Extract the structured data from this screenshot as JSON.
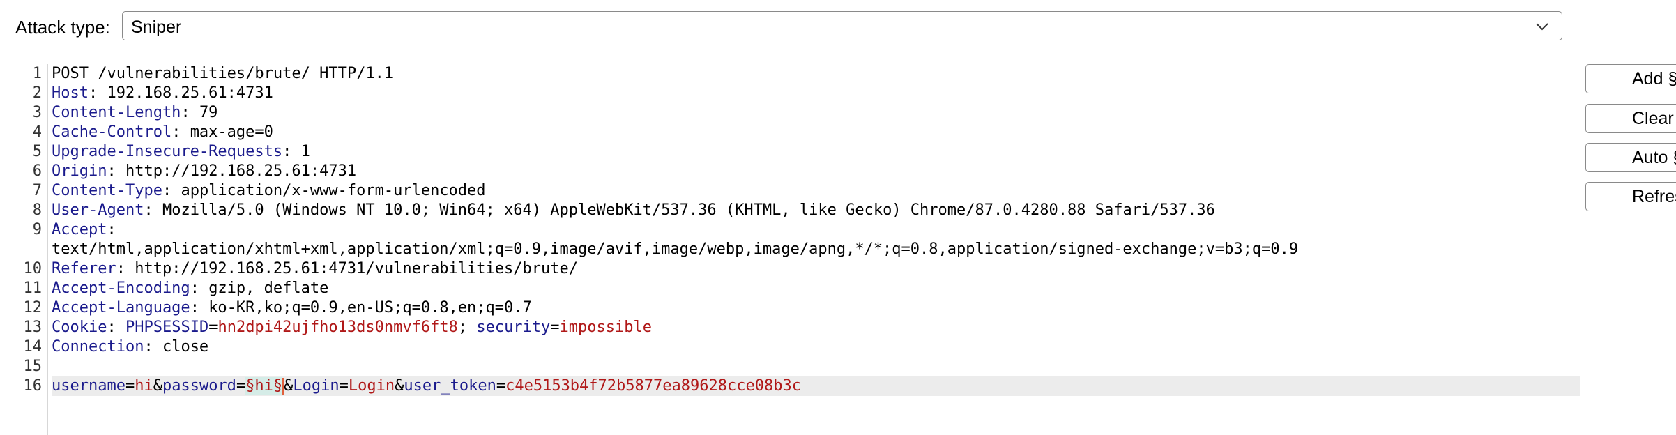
{
  "attack": {
    "label": "Attack type:",
    "selected": "Sniper",
    "dropdown_icon": "chevron-down-icon"
  },
  "buttons": {
    "add": "Add §",
    "clear": "Clear §",
    "auto": "Auto §",
    "refresh": "Refresh"
  },
  "editor": {
    "line_numbers": [
      "1",
      "2",
      "3",
      "4",
      "5",
      "6",
      "7",
      "8",
      "9",
      "",
      "10",
      "11",
      "12",
      "13",
      "14",
      "15",
      "16"
    ],
    "request_line": "POST /vulnerabilities/brute/ HTTP/1.1",
    "headers": [
      {
        "name": "Host",
        "sep": ": ",
        "value": "192.168.25.61:4731"
      },
      {
        "name": "Content-Length",
        "sep": ": ",
        "value": "79"
      },
      {
        "name": "Cache-Control",
        "sep": ": ",
        "value": "max-age=0"
      },
      {
        "name": "Upgrade-Insecure-Requests",
        "sep": ": ",
        "value": "1"
      },
      {
        "name": "Origin",
        "sep": ": ",
        "value": "http://192.168.25.61:4731"
      },
      {
        "name": "Content-Type",
        "sep": ": ",
        "value": "application/x-www-form-urlencoded"
      },
      {
        "name": "User-Agent",
        "sep": ": ",
        "value": "Mozilla/5.0 (Windows NT 10.0; Win64; x64) AppleWebKit/537.36 (KHTML, like Gecko) Chrome/87.0.4280.88 Safari/537.36"
      },
      {
        "name": "Accept",
        "sep": ":",
        "value": ""
      },
      {
        "name": "Referer",
        "sep": ": ",
        "value": "http://192.168.25.61:4731/vulnerabilities/brute/"
      },
      {
        "name": "Accept-Encoding",
        "sep": ": ",
        "value": "gzip, deflate"
      },
      {
        "name": "Accept-Language",
        "sep": ": ",
        "value": "ko-KR,ko;q=0.9,en-US;q=0.8,en;q=0.7"
      },
      {
        "name": "Connection",
        "sep": ": ",
        "value": "close"
      }
    ],
    "accept_wrap": "text/html,application/xhtml+xml,application/xml;q=0.9,image/avif,image/webp,image/apng,*/*;q=0.8,application/signed-exchange;v=b3;q=0.9",
    "cookie": {
      "name": "Cookie",
      "sep": ": ",
      "k1": "PHPSESSID",
      "eq1": "=",
      "v1": "hn2dpi42ujfho13ds0nmvf6ft8",
      "semi": "; ",
      "k2": "security",
      "eq2": "=",
      "v2": "impossible"
    },
    "body": {
      "k1": "username",
      "eq1": "=",
      "v1": "hi",
      "amp1": "&",
      "k2": "password",
      "eq2": "=",
      "marked": "§hi§",
      "amp2": "&",
      "k3": "Login",
      "eq3": "=",
      "v3": "Login",
      "amp3": "&",
      "k4": "user_token",
      "eq4": "=",
      "v4": "c4e5153b4f72b5877ea89628cce08b3c"
    }
  }
}
